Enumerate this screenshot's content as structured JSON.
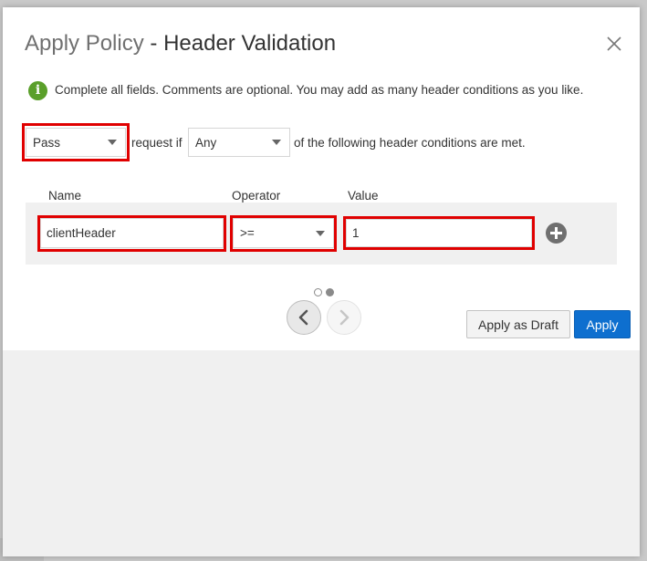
{
  "dialog": {
    "title_prefix": "Apply Policy",
    "title_separator": " - ",
    "title_main": "Header Validation",
    "close_icon": "close-icon"
  },
  "info": {
    "icon": "info-icon",
    "text": "Complete all fields. Comments are optional. You may add as many header conditions as you like."
  },
  "condition": {
    "action_value": "Pass",
    "request_if_text": "request if",
    "match_value": "Any",
    "suffix_text": "of the following header conditions are met."
  },
  "table": {
    "headers": {
      "name": "Name",
      "operator": "Operator",
      "value": "Value"
    },
    "rows": [
      {
        "name": "clientHeader",
        "operator": ">=",
        "value": "1"
      }
    ],
    "add_icon": "plus-circle-icon"
  },
  "pager": {
    "page_count": 2,
    "current_page": 2,
    "prev_icon": "chevron-left-icon",
    "next_icon": "chevron-right-icon"
  },
  "buttons": {
    "apply_draft_label": "Apply as Draft",
    "apply_label": "Apply"
  },
  "colors": {
    "highlight": "#e00000",
    "primary": "#0e6fcf",
    "info_green": "#5a9f2a"
  }
}
